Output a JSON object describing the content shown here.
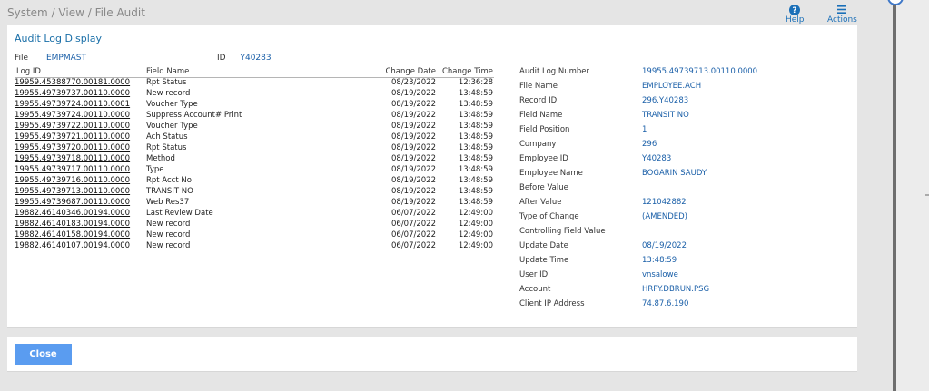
{
  "header": {
    "breadcrumb": "System / View / File Audit",
    "help_label": "Help",
    "actions_label": "Actions"
  },
  "panel": {
    "title": "Audit Log Display",
    "file_label": "File",
    "file_value": "EMPMAST",
    "id_label": "ID",
    "id_value": "Y40283"
  },
  "table": {
    "columns": [
      "Log ID",
      "Field Name",
      "Change Date",
      "Change Time"
    ],
    "rows": [
      [
        "19959.45388770.00181.0000",
        "Rpt Status",
        "08/23/2022",
        "12:36:28"
      ],
      [
        "19955.49739737.00110.0000",
        "New record",
        "08/19/2022",
        "13:48:59"
      ],
      [
        "19955.49739724.00110.0001",
        "Voucher Type",
        "08/19/2022",
        "13:48:59"
      ],
      [
        "19955.49739724.00110.0000",
        "Suppress Account# Print",
        "08/19/2022",
        "13:48:59"
      ],
      [
        "19955.49739722.00110.0000",
        "Voucher Type",
        "08/19/2022",
        "13:48:59"
      ],
      [
        "19955.49739721.00110.0000",
        "Ach Status",
        "08/19/2022",
        "13:48:59"
      ],
      [
        "19955.49739720.00110.0000",
        "Rpt Status",
        "08/19/2022",
        "13:48:59"
      ],
      [
        "19955.49739718.00110.0000",
        "Method",
        "08/19/2022",
        "13:48:59"
      ],
      [
        "19955.49739717.00110.0000",
        "Type",
        "08/19/2022",
        "13:48:59"
      ],
      [
        "19955.49739716.00110.0000",
        "Rpt Acct No",
        "08/19/2022",
        "13:48:59"
      ],
      [
        "19955.49739713.00110.0000",
        "TRANSIT NO",
        "08/19/2022",
        "13:48:59"
      ],
      [
        "19955.49739687.00110.0000",
        "Web Res37",
        "08/19/2022",
        "13:48:59"
      ],
      [
        "19882.46140346.00194.0000",
        "Last Review Date",
        "06/07/2022",
        "12:49:00"
      ],
      [
        "19882.46140183.00194.0000",
        "New record",
        "06/07/2022",
        "12:49:00"
      ],
      [
        "19882.46140158.00194.0000",
        "New record",
        "06/07/2022",
        "12:49:00"
      ],
      [
        "19882.46140107.00194.0000",
        "New record",
        "06/07/2022",
        "12:49:00"
      ]
    ]
  },
  "details": [
    {
      "label": "Audit Log Number",
      "value": "19955.49739713.00110.0000"
    },
    {
      "label": "File Name",
      "value": "EMPLOYEE.ACH"
    },
    {
      "label": "Record ID",
      "value": "296.Y40283"
    },
    {
      "label": "Field Name",
      "value": "TRANSIT NO"
    },
    {
      "label": "Field Position",
      "value": "1"
    },
    {
      "label": "Company",
      "value": "296"
    },
    {
      "label": "Employee ID",
      "value": "Y40283"
    },
    {
      "label": "Employee Name",
      "value": "BOGARIN SAUDY"
    },
    {
      "label": "Before Value",
      "value": ""
    },
    {
      "label": "After Value",
      "value": "121042882"
    },
    {
      "label": "Type of Change",
      "value": "(AMENDED)"
    },
    {
      "label": "Controlling Field Value",
      "value": ""
    },
    {
      "label": "Update Date",
      "value": "08/19/2022"
    },
    {
      "label": "Update Time",
      "value": "13:48:59"
    },
    {
      "label": "User ID",
      "value": "vnsalowe"
    },
    {
      "label": "Account",
      "value": "HRPY.DBRUN.PSG"
    },
    {
      "label": "Client IP Address",
      "value": "74.87.6.190"
    }
  ],
  "footer": {
    "close_label": "Close"
  },
  "colors": {
    "accent": "#5a9cf0",
    "link": "#1a5fa8",
    "title": "#1a6fa8"
  },
  "icons": {
    "help": "help-circle-icon",
    "actions": "menu-icon"
  }
}
